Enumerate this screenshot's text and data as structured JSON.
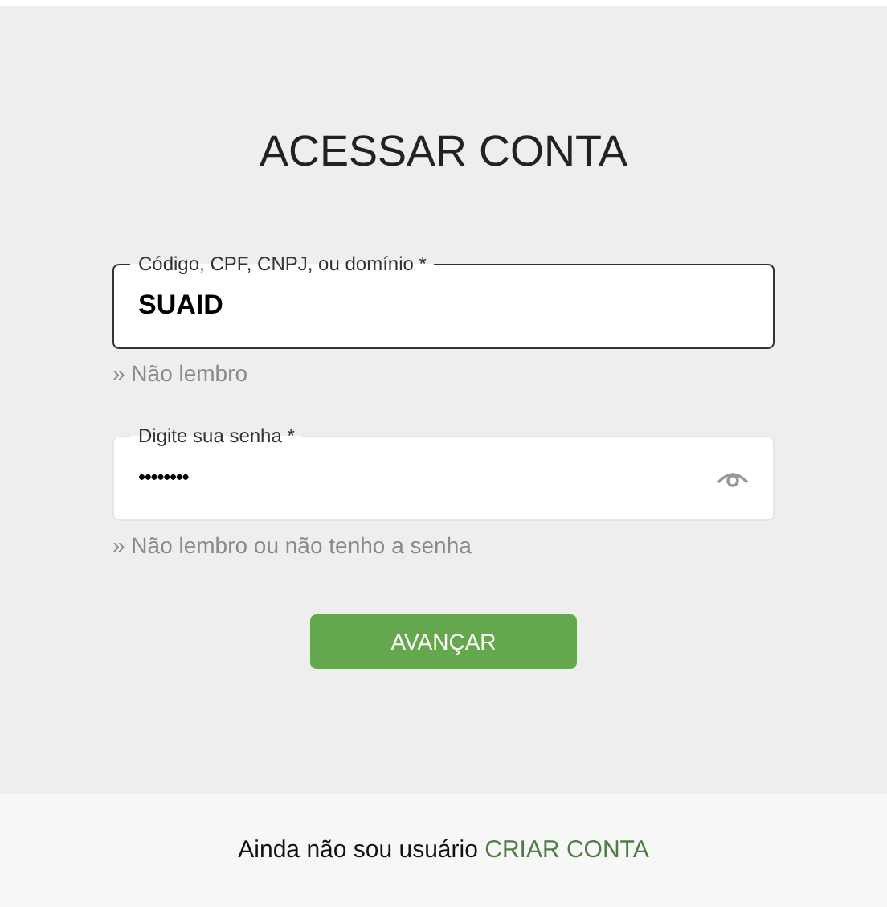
{
  "title": "ACESSAR CONTA",
  "fields": [
    {
      "label": "Código, CPF, CNPJ, ou domínio *",
      "value": "SUAID",
      "focused": true,
      "hint": "» Não lembro",
      "kind": "text"
    },
    {
      "label": "Digite sua senha *",
      "value": "••••••••",
      "focused": false,
      "hint": "» Não lembro ou não tenho a senha",
      "kind": "password"
    }
  ],
  "submit_button": "AVANÇAR",
  "footer": {
    "text": "Ainda não sou usuário",
    "link": "CRIAR CONTA"
  }
}
